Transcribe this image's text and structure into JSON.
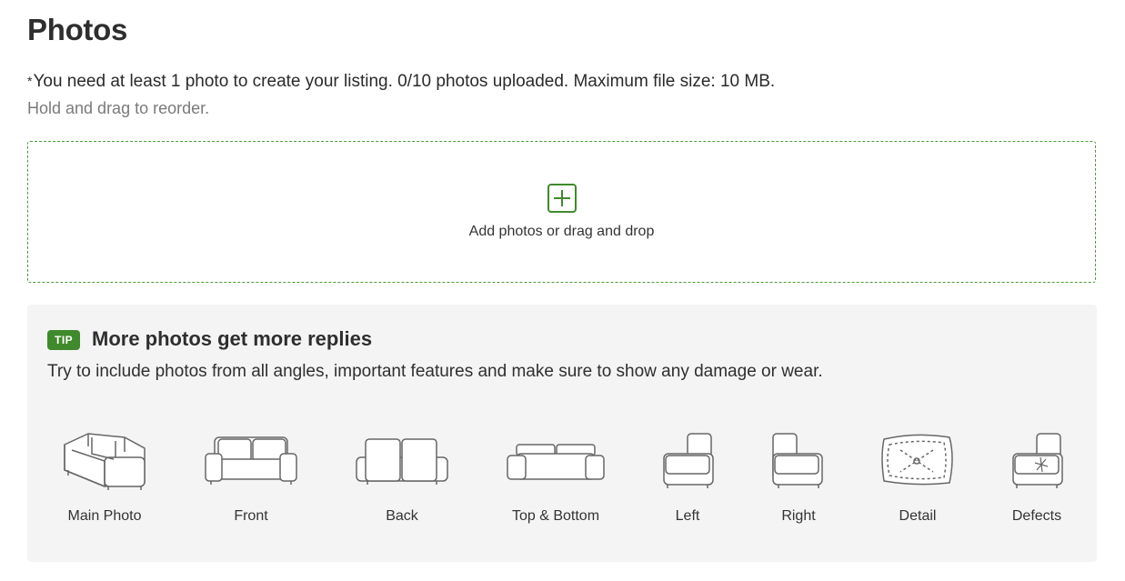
{
  "header": {
    "title": "Photos",
    "requirement_star": "*",
    "requirement_text": "You need at least 1 photo to create your listing. 0/10 photos uploaded. Maximum file size: 10 MB.",
    "reorder_hint": "Hold and drag to reorder."
  },
  "dropzone": {
    "icon": "plus-square-icon",
    "label": "Add photos or drag and drop"
  },
  "tip": {
    "badge": "TIP",
    "title": "More photos get more replies",
    "text": "Try to include photos from all angles, important features and make sure to show any damage or wear.",
    "angles": [
      {
        "label": "Main Photo",
        "icon": "sofa-main-icon"
      },
      {
        "label": "Front",
        "icon": "sofa-front-icon"
      },
      {
        "label": "Back",
        "icon": "sofa-back-icon"
      },
      {
        "label": "Top & Bottom",
        "icon": "sofa-top-icon"
      },
      {
        "label": "Left",
        "icon": "sofa-left-icon"
      },
      {
        "label": "Right",
        "icon": "sofa-right-icon"
      },
      {
        "label": "Detail",
        "icon": "sofa-detail-icon"
      },
      {
        "label": "Defects",
        "icon": "sofa-defects-icon"
      }
    ]
  },
  "colors": {
    "accent": "#3f8a2c",
    "tip_background": "#f4f4f4"
  }
}
